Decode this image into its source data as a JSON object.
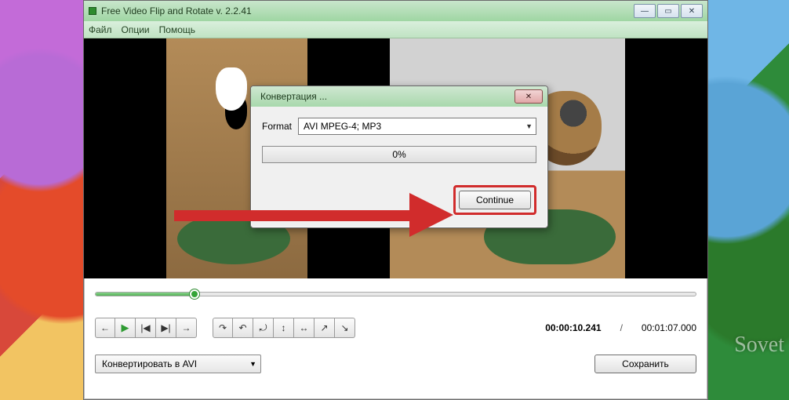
{
  "app": {
    "title": "Free Video Flip and Rotate v. 2.2.41"
  },
  "menu": {
    "file": "Файл",
    "options": "Опции",
    "help": "Помощь"
  },
  "dialog": {
    "title": "Конвертация ...",
    "format_label": "Format",
    "format_value": "AVI MPEG-4; MP3",
    "progress_text": "0%",
    "continue": "Continue"
  },
  "times": {
    "current": "00:00:10.241",
    "separator": "/",
    "total": "00:01:07.000"
  },
  "convert_select": "Конвертировать в AVI",
  "save": "Сохранить",
  "watermark": "Sovet"
}
